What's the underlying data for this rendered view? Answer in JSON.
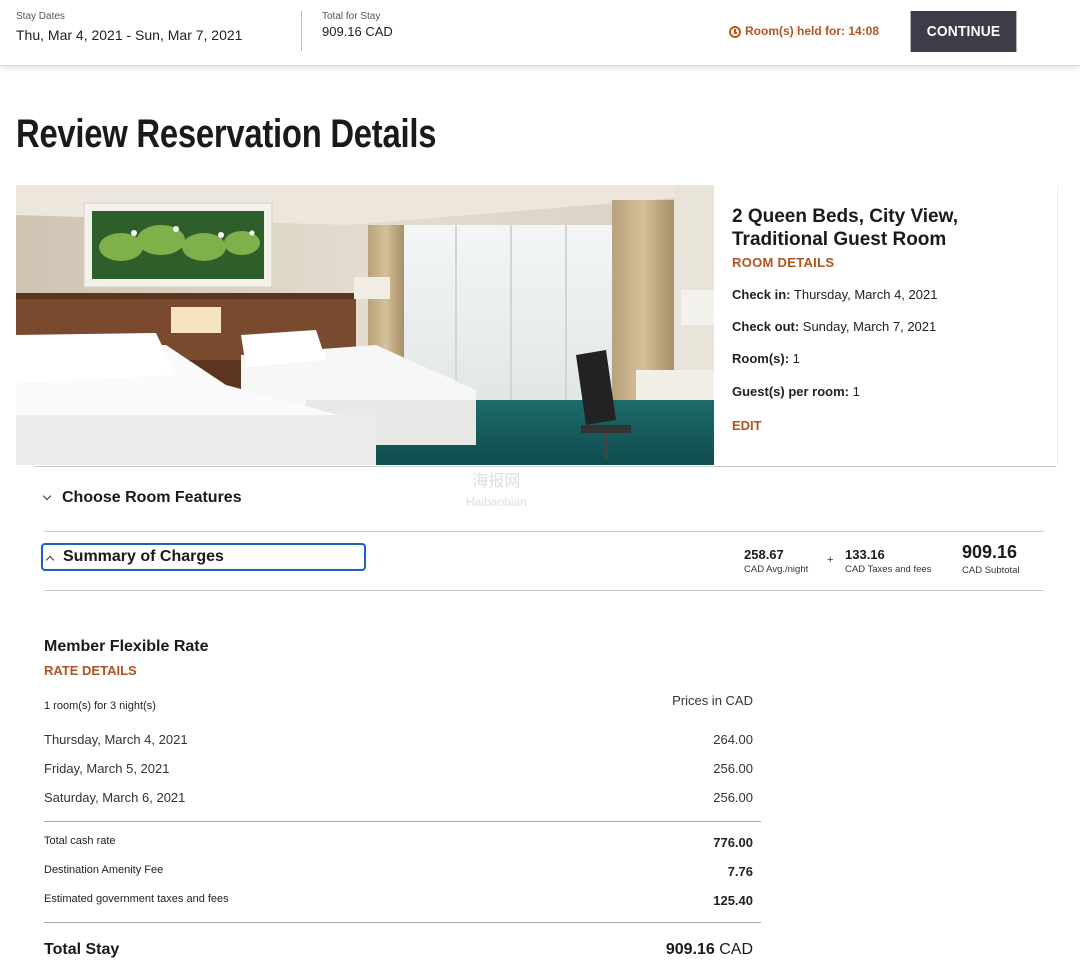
{
  "header": {
    "stay_dates_label": "Stay Dates",
    "stay_dates_value": "Thu, Mar 4, 2021 - Sun, Mar 7, 2021",
    "total_label": "Total for Stay",
    "total_value": "909.16 CAD",
    "held_text": "Room(s) held for: 14:08",
    "continue_label": "CONTINUE",
    "accent_color": "#b5541f"
  },
  "page_title": "Review Reservation Details",
  "room": {
    "title": "2 Queen Beds, City View, Traditional Guest Room",
    "details_link": "ROOM DETAILS",
    "checkin_label": "Check in:",
    "checkin_value": " Thursday, March 4, 2021",
    "checkout_label": "Check out:",
    "checkout_value": " Sunday, March 7, 2021",
    "rooms_label": "Room(s):",
    "rooms_value": " 1",
    "guests_label": "Guest(s) per room:",
    "guests_value": " 1",
    "edit_link": "EDIT"
  },
  "sections": {
    "choose_features": "Choose Room Features",
    "summary": "Summary of Charges"
  },
  "summary_charges": {
    "avg_value": "258.67",
    "avg_label": "CAD Avg./night",
    "plus": "+",
    "taxes_value": "133.16",
    "taxes_label": "CAD Taxes and fees",
    "subtotal_value": "909.16",
    "subtotal_label": "CAD Subtotal"
  },
  "rate": {
    "title": "Member Flexible Rate",
    "details_link": "RATE DETAILS",
    "nights": "1 room(s) for 3 night(s)",
    "prices_in": "Prices in CAD",
    "days": [
      {
        "date": "Thursday, March 4, 2021",
        "price": "264.00"
      },
      {
        "date": "Friday, March 5, 2021",
        "price": "256.00"
      },
      {
        "date": "Saturday, March 6, 2021",
        "price": "256.00"
      }
    ],
    "totals": [
      {
        "label": "Total cash rate",
        "value": "776.00"
      },
      {
        "label": "Destination Amenity Fee",
        "value": "7.76"
      },
      {
        "label": "Estimated government taxes and fees",
        "value": "125.40"
      }
    ],
    "total_stay_label": "Total Stay",
    "total_stay_value": "909.16",
    "total_stay_currency": " CAD"
  },
  "watermark": {
    "line1": "海报网",
    "line2": "Haibaobian"
  }
}
